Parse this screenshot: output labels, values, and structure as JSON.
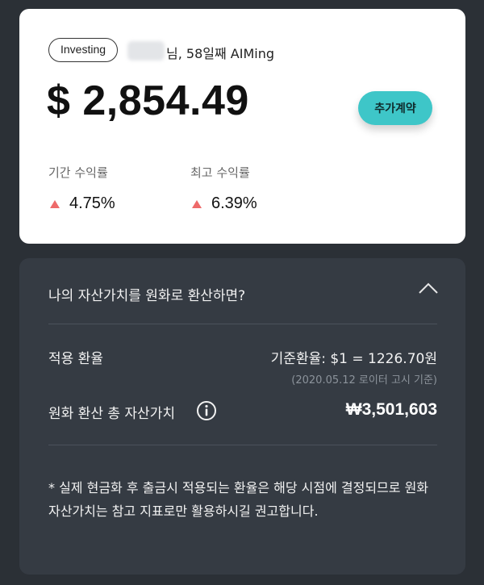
{
  "summary": {
    "badge": "Investing",
    "greeting": "님, 58일째 AIMing",
    "balance": "$ 2,854.49",
    "add_contract_label": "추가계약",
    "stats": [
      {
        "label": "기간 수익률",
        "value": "4.75%"
      },
      {
        "label": "최고 수익률",
        "value": "6.39%"
      }
    ],
    "up_color": "#ee6a6a",
    "accent": "#3ec6c8"
  },
  "conversion": {
    "title": "나의 자산가치를 원화로 환산하면?",
    "applied_rate_label": "적용 환율",
    "rate_text": "기준환율: $1 = 1226.70원",
    "rate_date": "(2020.05.12 로이터 고시 기준)",
    "total_label": "원화 환산 총 자산가치",
    "total_value": "₩3,501,603",
    "note": "* 실제 현금화 후 출금시 적용되는 환율은 해당 시점에 결정되므로 원화 자산가치는 참고 지표로만 활용하시길 권고합니다."
  }
}
